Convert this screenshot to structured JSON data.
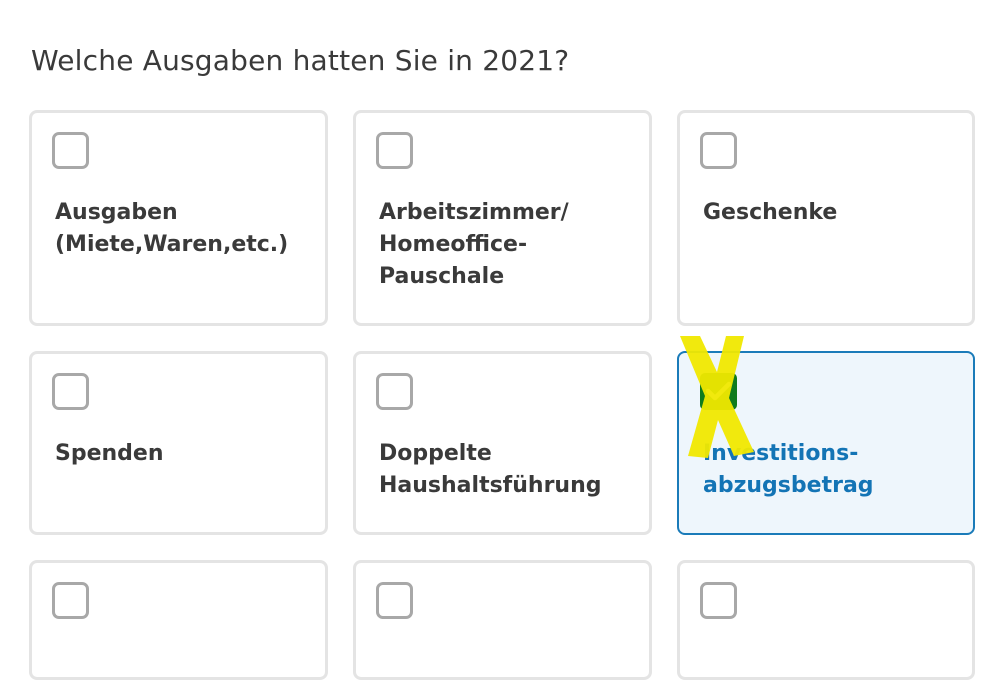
{
  "page": {
    "question": "Welche Ausgaben hatten Sie in 2021?"
  },
  "options": [
    {
      "lines": [
        "Ausgaben",
        "(Miete,Waren,etc.)"
      ],
      "checked": false
    },
    {
      "lines": [
        "Arbeitszimmer/",
        "Homeoffice-",
        "Pauschale"
      ],
      "checked": false
    },
    {
      "lines": [
        "Geschenke"
      ],
      "checked": false
    },
    {
      "lines": [
        "Spenden"
      ],
      "checked": false
    },
    {
      "lines": [
        "Doppelte",
        "Haushaltsführung"
      ],
      "checked": false
    },
    {
      "lines": [
        "Investitions-",
        "abzugsbetrag"
      ],
      "checked": true
    },
    {
      "lines": [],
      "checked": false
    },
    {
      "lines": [],
      "checked": false
    },
    {
      "lines": [],
      "checked": false
    }
  ],
  "colors": {
    "card_border": "#e4e4e4",
    "checkbox_border": "#a8a8a8",
    "selected_border": "#1a7bb9",
    "selected_bg": "#eef6fc",
    "selected_text": "#1374b5",
    "check_fill": "#0f7b1d",
    "text": "#3a3a3a",
    "highlight_mark": "#f0e800"
  },
  "icons": {
    "unchecked": "checkbox-empty-icon",
    "checked": "checkmark-icon",
    "annotation": "yellow-x-mark"
  }
}
